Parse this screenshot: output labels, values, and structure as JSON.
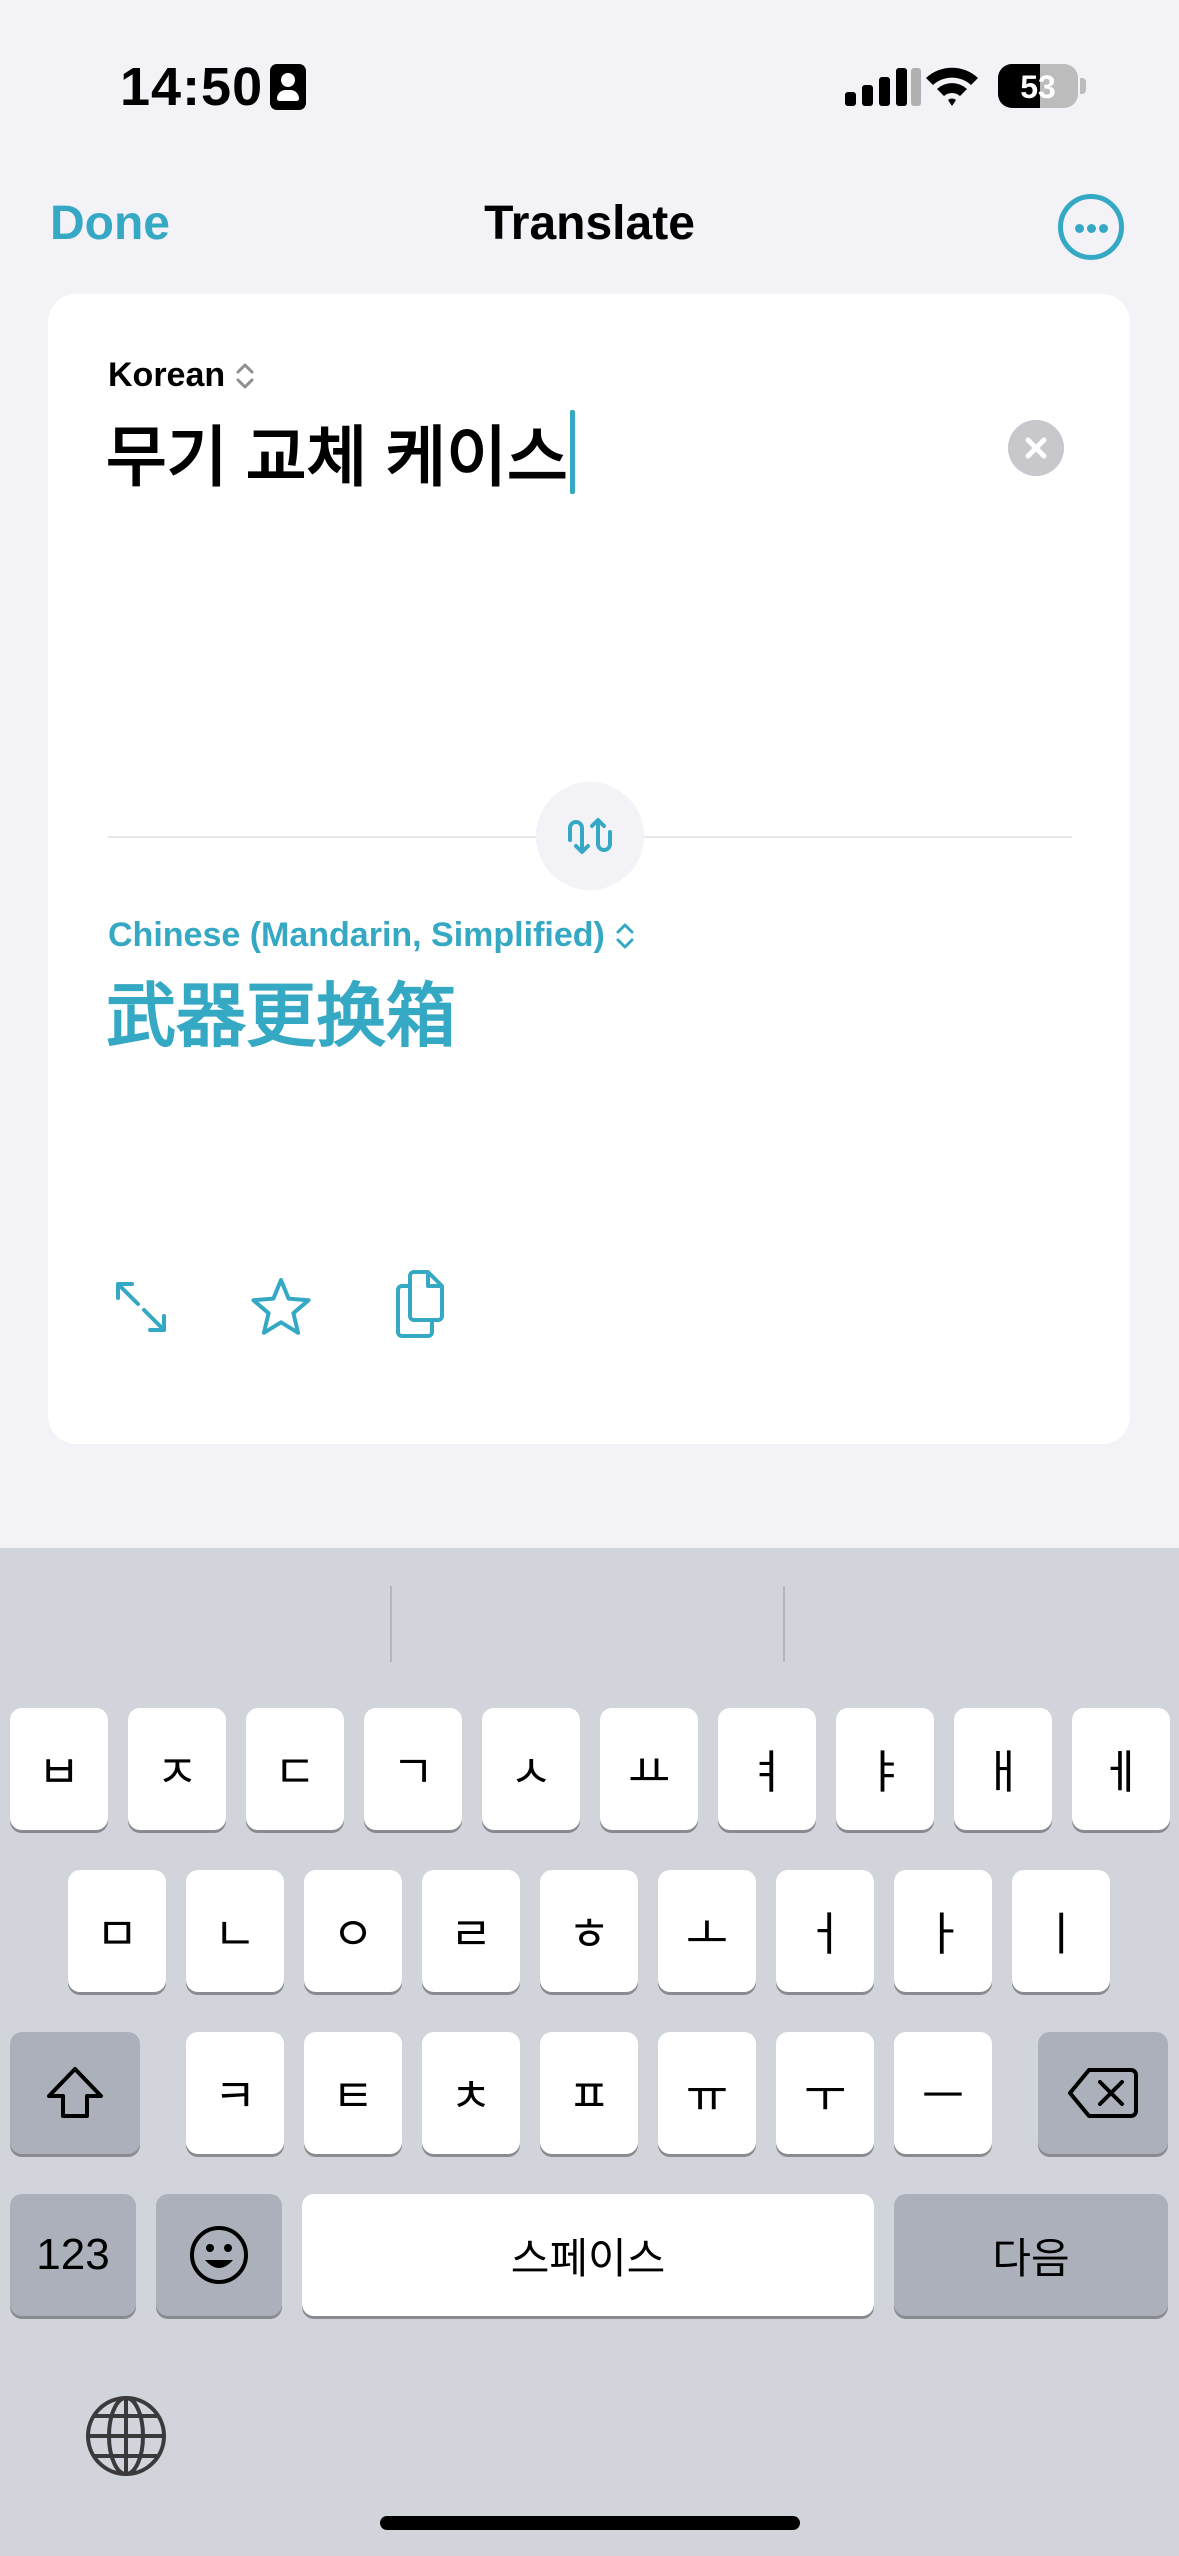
{
  "status_bar": {
    "time": "14:50",
    "battery_level": "53"
  },
  "nav": {
    "done_label": "Done",
    "title": "Translate",
    "more_icon": "ellipsis-circle-icon"
  },
  "source": {
    "language": "Korean",
    "text": "무기 교체 케이스"
  },
  "target": {
    "language": "Chinese (Mandarin, Simplified)",
    "text": "武器更换箱"
  },
  "actions": [
    "expand-icon",
    "favorite-star-icon",
    "copy-icon"
  ],
  "colors": {
    "accent": "#35a9c4",
    "background": "#f2f2f7",
    "keyboard": "#d1d4db"
  },
  "keyboard": {
    "row1": [
      "ㅂ",
      "ㅈ",
      "ㄷ",
      "ㄱ",
      "ㅅ",
      "ㅛ",
      "ㅕ",
      "ㅑ",
      "ㅐ",
      "ㅔ"
    ],
    "row2": [
      "ㅁ",
      "ㄴ",
      "ㅇ",
      "ㄹ",
      "ㅎ",
      "ㅗ",
      "ㅓ",
      "ㅏ",
      "ㅣ"
    ],
    "row3": [
      "ㅋ",
      "ㅌ",
      "ㅊ",
      "ㅍ",
      "ㅠ",
      "ㅜ",
      "ㅡ"
    ],
    "numbers_label": "123",
    "space_label": "스페이스",
    "return_label": "다음"
  }
}
